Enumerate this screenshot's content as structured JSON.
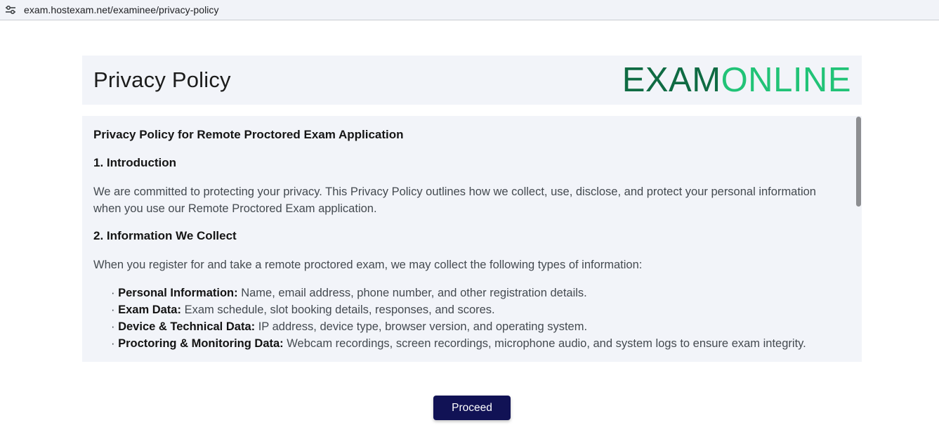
{
  "browser": {
    "url": "exam.hostexam.net/examinee/privacy-policy"
  },
  "header": {
    "title": "Privacy Policy",
    "logo_part1": "EXAM",
    "logo_part2": "ONLINE"
  },
  "policy": {
    "doc_title": "Privacy Policy for Remote Proctored Exam Application",
    "sections": [
      {
        "heading": "1. Introduction",
        "paragraph": "We are committed to protecting your privacy. This Privacy Policy outlines how we collect, use, disclose, and protect your personal information when you use our Remote Proctored Exam application."
      },
      {
        "heading": "2. Information We Collect",
        "paragraph": "When you register for and take a remote proctored exam, we may collect the following types of information:",
        "bullets": [
          {
            "label": "Personal Information:",
            "text": "Name, email address, phone number, and other registration details."
          },
          {
            "label": "Exam Data:",
            "text": "Exam schedule, slot booking details, responses, and scores."
          },
          {
            "label": "Device & Technical Data:",
            "text": "IP address, device type, browser version, and operating system."
          },
          {
            "label": "Proctoring & Monitoring Data:",
            "text": "Webcam recordings, screen recordings, microphone audio, and system logs to ensure exam integrity."
          }
        ]
      }
    ]
  },
  "footer": {
    "proceed_label": "Proceed"
  },
  "colors": {
    "logo_dark": "#0f6b43",
    "logo_light": "#21c377",
    "button": "#111255",
    "panel": "#f2f4f9"
  }
}
